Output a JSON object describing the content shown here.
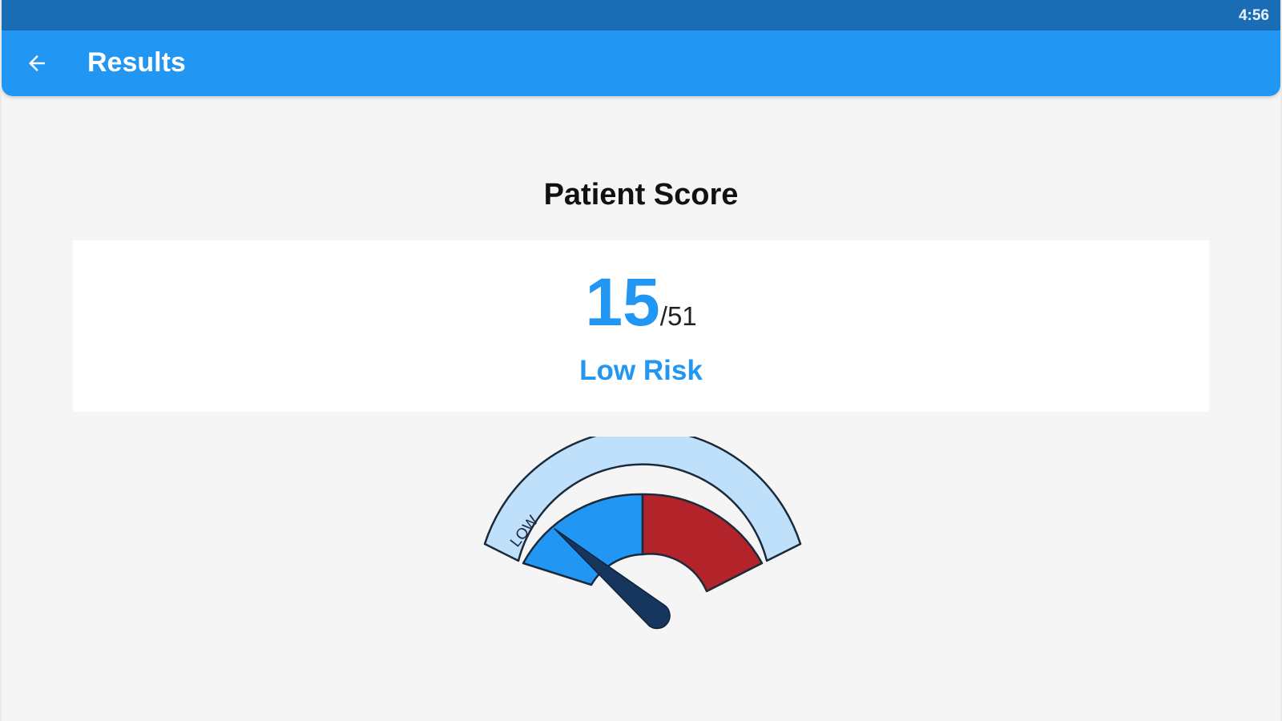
{
  "status_bar": {
    "time": "4:56"
  },
  "app_bar": {
    "title": "Results",
    "back_icon": "arrow-left-icon"
  },
  "score": {
    "heading": "Patient Score",
    "value": "15",
    "max_text": "/51",
    "risk": "Low Risk"
  },
  "gauge": {
    "segment_label": "LOW",
    "value": 15,
    "max": 51,
    "colors": {
      "outer": "#bfe0fb",
      "low": "#2196f3",
      "high": "#b3232a",
      "needle": "#17365d",
      "outline": "#1b2a3a"
    }
  },
  "colors": {
    "status_bar": "#1a6db5",
    "app_bar": "#2196f3",
    "accent": "#2196f3",
    "background": "#f5f5f5"
  }
}
